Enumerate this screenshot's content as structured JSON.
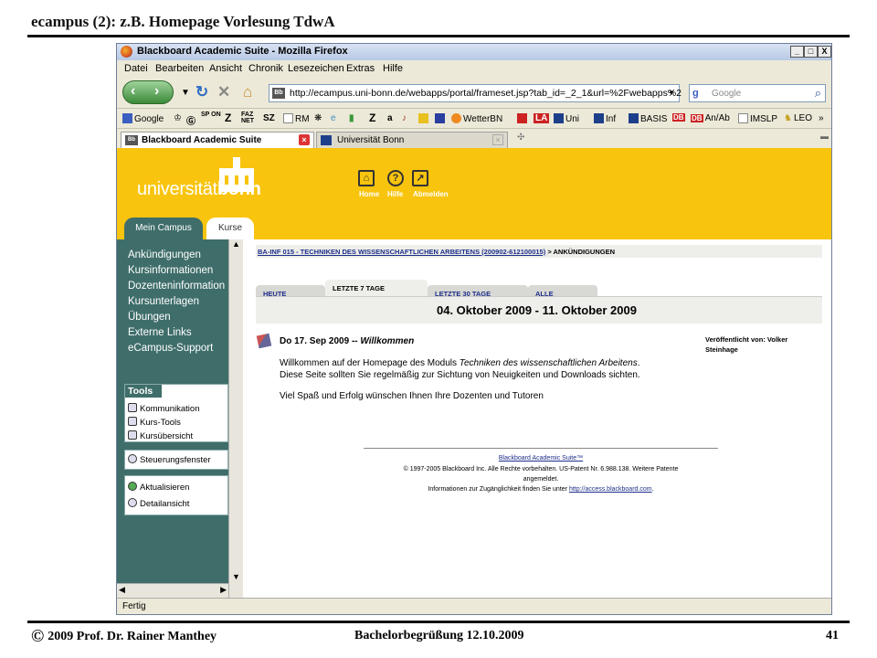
{
  "slide": {
    "title": "ecampus (2): z.B. Homepage Vorlesung TdwA",
    "footer_copyright_symbol": "©",
    "footer_author": "2009  Prof. Dr. Rainer Manthey",
    "footer_event": "Bachelorbegrüßung 12.10.2009",
    "page_number": "41"
  },
  "browser": {
    "window_title": "Blackboard Academic Suite - Mozilla Firefox",
    "window_buttons": [
      "_",
      "□",
      "X"
    ],
    "menu": [
      "Datei",
      "Bearbeiten",
      "Ansicht",
      "Chronik",
      "Lesezeichen",
      "Extras",
      "Hilfe"
    ],
    "url": "http://ecampus.uni-bonn.de/webapps/portal/frameset.jsp?tab_id=_2_1&url=%2Fwebapps%2",
    "url_favicon": "Bb",
    "search_placeholder": "Google",
    "bookmarks": [
      "Google",
      "RM",
      "WetterBN",
      "Uni",
      "Inf",
      "BASIS",
      "An/Ab",
      "IMSLP",
      "LEO"
    ],
    "bookmark_icons": [
      "SP ON",
      "Z",
      "FAZ NET",
      "SZ",
      "DB",
      "DB",
      "LA",
      "a",
      "Z"
    ],
    "tabs": [
      {
        "label": "Blackboard Academic Suite",
        "active": true
      },
      {
        "label": "Universität Bonn",
        "active": false
      }
    ],
    "status": "Fertig"
  },
  "portal": {
    "logo_regular": "universität",
    "logo_bold": "bonn",
    "header_links": [
      "Home",
      "Hilfe",
      "Abmelden"
    ],
    "main_tabs": [
      {
        "label": "Mein Campus",
        "active": false
      },
      {
        "label": "Kurse",
        "active": true
      }
    ],
    "sidebar_nav": [
      "Ankündigungen",
      "Kursinformationen",
      "Dozenteninformation",
      "Kursunterlagen",
      "Übungen",
      "Externe Links",
      "eCampus-Support"
    ],
    "tools_title": "Tools",
    "tools": [
      "Kommunikation",
      "Kurs-Tools",
      "Kursübersicht"
    ],
    "control_panel": "Steuerungsfenster",
    "actions": [
      "Aktualisieren",
      "Detailansicht"
    ]
  },
  "course": {
    "breadcrumb_link": "BA-INF 015 - TECHNIKEN DES WISSENSCHAFTLICHEN ARBEITENS (200902-612100015)",
    "breadcrumb_sep": ">",
    "breadcrumb_current": "ANKÜNDIGUNGEN",
    "filter_tabs": [
      {
        "label": "HEUTE",
        "active": false
      },
      {
        "label": "LETZTE 7 TAGE",
        "active": true
      },
      {
        "label": "LETZTE 30 TAGE",
        "active": false
      },
      {
        "label": "ALLE",
        "active": false
      }
    ],
    "date_range": "04. Oktober 2009 - 11. Oktober 2009",
    "announcement": {
      "date": "Do 17. Sep 2009",
      "separator": "--",
      "title": "Willkommen",
      "line1_start": "Willkommen auf der Homepage des Moduls ",
      "line1_italic": "Techniken des wissenschaftlichen Arbeitens",
      "line1_end": ".",
      "line2": "Diese Seite sollten Sie regelmäßig zur Sichtung von Neuigkeiten und Downloads sichten.",
      "line3": "Viel Spaß und Erfolg wünschen Ihnen Ihre Dozenten und Tutoren",
      "posted_by_label": "Veröffentlicht von: Volker",
      "posted_by_name": "Steinhage"
    },
    "footer_link": "Blackboard Academic Suite™",
    "footer_copyright_1": "© 1997-2005 Blackboard Inc. Alle Rechte vorbehalten. US-Patent Nr. 6.988.138. Weitere Patente",
    "footer_copyright_2": "angemeldet.",
    "footer_access_text": "Informationen zur Zugänglichkeit finden Sie unter ",
    "footer_access_link": "http://access.blackboard.com",
    "footer_access_end": "."
  },
  "colors": {
    "header_yellow": "#f8c40e",
    "sidebar_green": "#3f6e6a",
    "link_blue": "#1d2e8a"
  }
}
